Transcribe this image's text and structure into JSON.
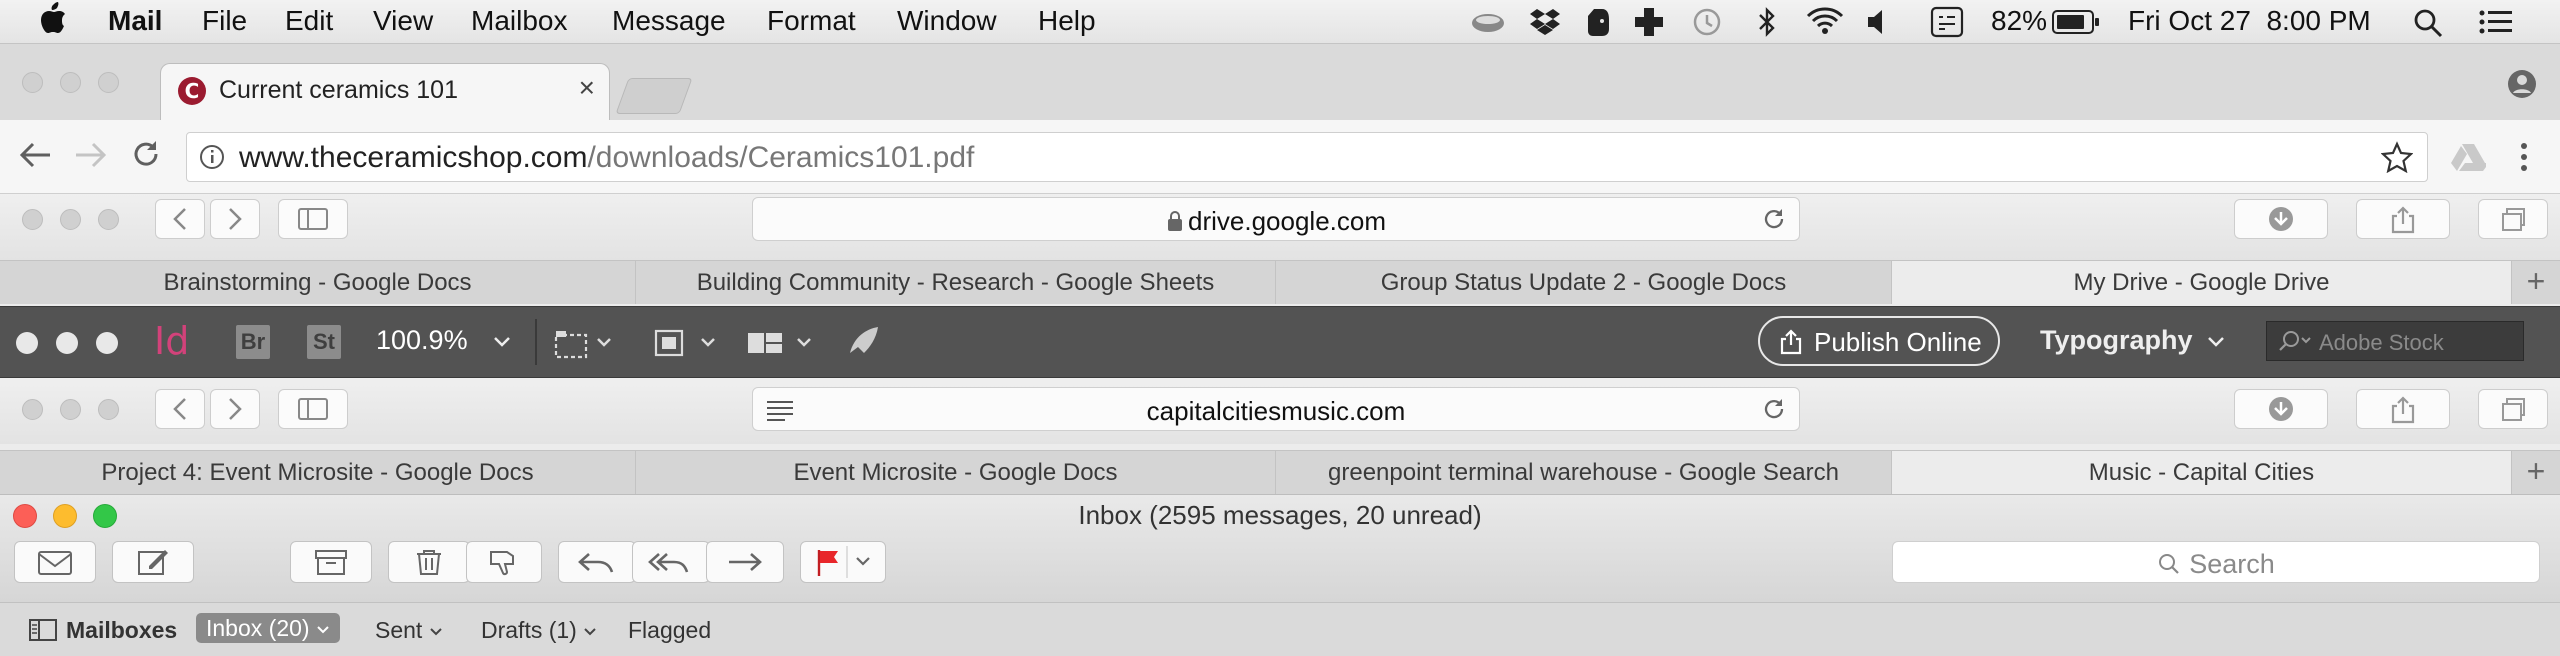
{
  "menubar": {
    "app_name": "Mail",
    "menus": [
      "File",
      "Edit",
      "View",
      "Mailbox",
      "Message",
      "Format",
      "Window",
      "Help"
    ],
    "battery": "82%",
    "clock": "Fri Oct 27  8:00 PM",
    "status_icons": [
      "teacup-icon",
      "dropbox-icon",
      "evernote-icon",
      "plus-app-icon",
      "time-machine-icon",
      "bluetooth-icon",
      "wifi-icon",
      "volume-icon",
      "input-menu-icon",
      "battery-icon",
      "spotlight-icon",
      "notification-center-icon"
    ]
  },
  "chrome": {
    "tab_title": "Current ceramics 101",
    "url_domain": "www.theceramicshop.com",
    "url_path": "/downloads/Ceramics101.pdf",
    "favicon_letter": "C"
  },
  "safari1": {
    "address": "drive.google.com",
    "tabs": [
      "Brainstorming - Google Docs",
      "Building Community - Research - Google Sheets",
      "Group Status Update 2 - Google Docs",
      "My Drive - Google Drive"
    ],
    "active_tab": 3
  },
  "indesign": {
    "logo": "Id",
    "bridge": "Br",
    "stock_app": "St",
    "zoom": "100.9%",
    "publish_label": "Publish Online",
    "workspace": "Typography",
    "search_placeholder": "Adobe Stock"
  },
  "safari2": {
    "address": "capitalcitiesmusic.com",
    "tabs": [
      "Project 4: Event Microsite - Google Docs",
      "Event Microsite - Google Docs",
      "greenpoint terminal warehouse - Google Search",
      "Music - Capital Cities"
    ],
    "active_tab": 3
  },
  "mail": {
    "title": "Inbox (2595 messages, 20 unread)",
    "search_placeholder": "Search",
    "favorites": {
      "mailboxes": "Mailboxes",
      "inbox": "Inbox (20)",
      "sent": "Sent",
      "drafts": "Drafts (1)",
      "flagged": "Flagged"
    },
    "colors": {
      "close": "#fc5f57",
      "minimize": "#fdbc2e",
      "zoom": "#33c748",
      "flag": "#e8262a"
    }
  }
}
